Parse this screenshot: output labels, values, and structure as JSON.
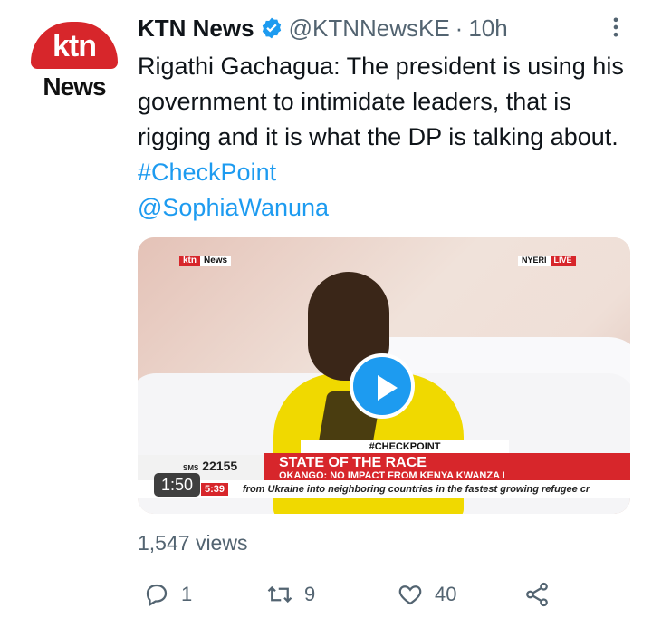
{
  "tweet": {
    "author": {
      "name": "KTN News",
      "handle": "@KTNNewsKE",
      "time": "10h",
      "separator": "·",
      "avatar": {
        "text_top": "ktn",
        "text_bottom": "News",
        "brand_color": "#d7262b"
      }
    },
    "text": {
      "body": "Rigathi Gachagua: The president is using his government to intimidate leaders, that is rigging and it is what the DP is talking about.",
      "hashtag": "#CheckPoint",
      "mention": "@SophiaWanuna"
    },
    "media": {
      "duration": "1:50",
      "channel_logo": {
        "ktn": "ktn",
        "news": "News"
      },
      "location": "NYERI",
      "live": "LIVE",
      "banner_tag": "#CHECKPOINT",
      "sms_number": "22155",
      "sms_label": "SMS",
      "headline": "STATE OF THE RACE",
      "subheadline": "OKANGO: NO IMPACT FROM KENYA KWANZA I",
      "ticker_time": "5:39",
      "ticker": "from Ukraine into neighboring countries in the fastest growing refugee cr"
    },
    "views": "1,547 views",
    "actions": {
      "replies": "1",
      "retweets": "9",
      "likes": "40"
    },
    "colors": {
      "link": "#1d9bf0",
      "secondary": "#536471",
      "text": "#0f1419"
    }
  }
}
